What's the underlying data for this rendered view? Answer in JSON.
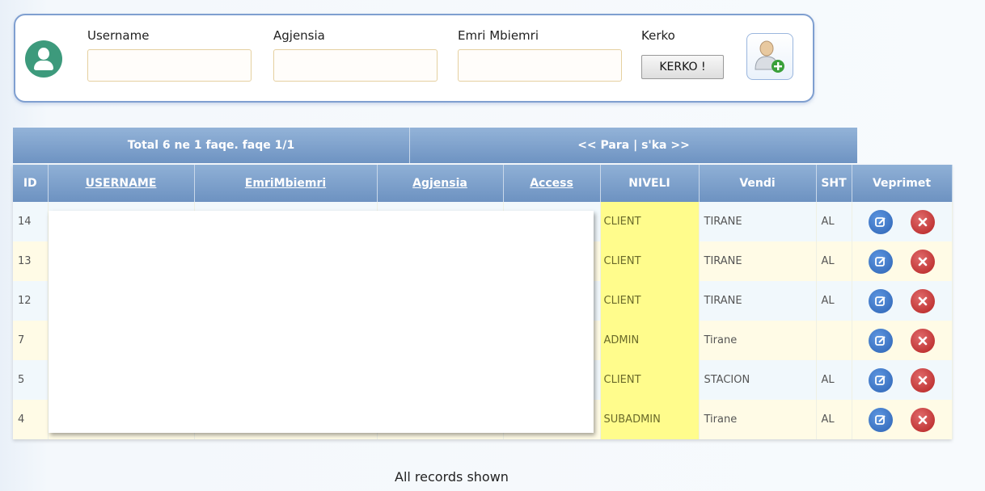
{
  "search": {
    "username_label": "Username",
    "agjensia_label": "Agjensia",
    "emri_label": "Emri Mbiemri",
    "kerko_label": "Kerko",
    "kerko_button": "KERKO !",
    "username_value": "",
    "agjensia_value": "",
    "emri_value": ""
  },
  "pager": {
    "total": "Total 6 ne 1 faqe. faqe 1/1",
    "nav": "<< Para | s'ka >>"
  },
  "columns": {
    "id": "ID",
    "username": "USERNAME",
    "emri": "EmriMbiemri",
    "agjensia": "Agjensia",
    "access": "Access",
    "niveli": "NIVELI",
    "vendi": "Vendi",
    "sht": "SHT",
    "veprimet": "Veprimet"
  },
  "rows": [
    {
      "id": "14",
      "niveli": "CLIENT",
      "vendi": "TIRANE",
      "sht": "AL"
    },
    {
      "id": "13",
      "niveli": "CLIENT",
      "vendi": "TIRANE",
      "sht": "AL"
    },
    {
      "id": "12",
      "niveli": "CLIENT",
      "vendi": "TIRANE",
      "sht": "AL"
    },
    {
      "id": "7",
      "niveli": "ADMIN",
      "vendi": "Tirane",
      "sht": ""
    },
    {
      "id": "5",
      "niveli": "CLIENT",
      "vendi": "STACION",
      "sht": "AL"
    },
    {
      "id": "4",
      "niveli": "SUBADMIN",
      "vendi": "Tirane",
      "sht": "AL"
    }
  ],
  "footer": "All records shown",
  "colors": {
    "header_blue": "#7d9fcb",
    "niveli_yellow": "#fffc8c",
    "edit_blue": "#2d63b4",
    "delete_red": "#b52222",
    "avatar_green": "#3d9a7c"
  },
  "icons": {
    "avatar": "user-avatar-icon",
    "add_user": "add-user-icon",
    "edit": "edit-icon",
    "delete": "delete-icon"
  }
}
